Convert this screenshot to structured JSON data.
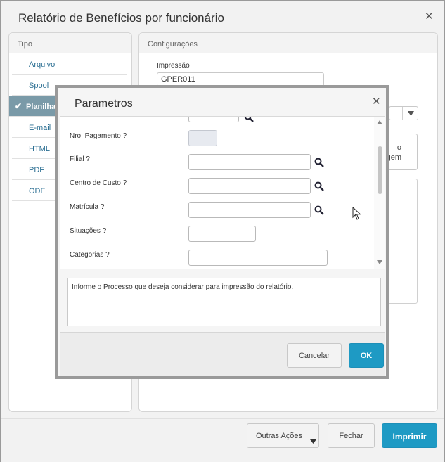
{
  "dialog": {
    "title": "Relatório de Benefícios por funcionário",
    "close_symbol": "✕"
  },
  "tipo_panel": {
    "header": "Tipo",
    "items": [
      {
        "label": "Arquivo",
        "selected": false
      },
      {
        "label": "Spool",
        "selected": false
      },
      {
        "label": "Planilha",
        "selected": true
      },
      {
        "label": "E-mail",
        "selected": false
      },
      {
        "label": "HTML",
        "selected": false
      },
      {
        "label": "PDF",
        "selected": false
      },
      {
        "label": "ODF",
        "selected": false
      }
    ],
    "check_symbol": "✔"
  },
  "config_panel": {
    "header": "Configurações",
    "impressao_label": "Impressão",
    "impressao_value": "GPER011",
    "partial_button_text_line1": "o",
    "partial_button_text_line2": "gem"
  },
  "modal": {
    "title": "Parametros",
    "close_symbol": "✕",
    "params": [
      {
        "label": "Nro. Pagamento ?",
        "value": "",
        "disabled": true,
        "lookup": false
      },
      {
        "label": "Filial ?",
        "value": "",
        "disabled": false,
        "lookup": true
      },
      {
        "label": "Centro de Custo ?",
        "value": "",
        "disabled": false,
        "lookup": true
      },
      {
        "label": "Matrícula ?",
        "value": "",
        "disabled": false,
        "lookup": true
      },
      {
        "label": "Situações ?",
        "value": "",
        "disabled": false,
        "lookup": false
      },
      {
        "label": "Categorias ?",
        "value": "",
        "disabled": false,
        "lookup": false
      }
    ],
    "help_text": "Informe o Processo que deseja considerar para impressão do relatório.",
    "cancel_label": "Cancelar",
    "ok_label": "OK"
  },
  "footer": {
    "other_actions_label": "Outras Ações",
    "close_label": "Fechar",
    "print_label": "Imprimir"
  },
  "colors": {
    "accent": "#1e9ac4",
    "selected_item_bg": "#7a9aa8",
    "link": "#2a6e92"
  }
}
